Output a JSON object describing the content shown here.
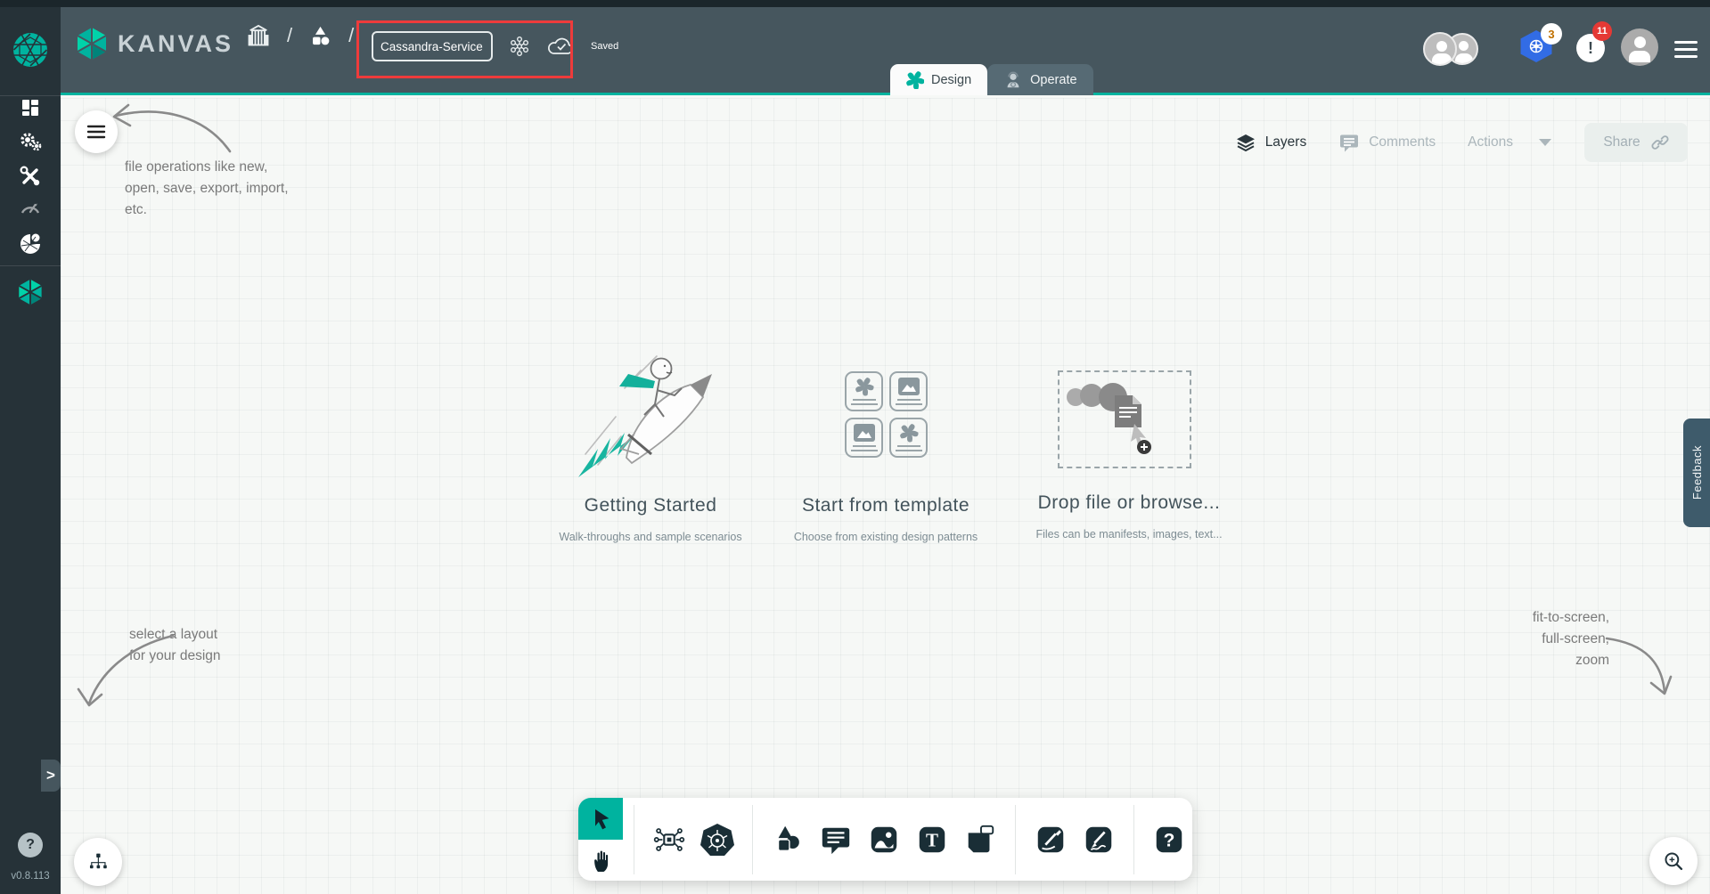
{
  "brand": {
    "name": "KANVAS"
  },
  "sidebar": {
    "items": [
      "dashboard",
      "settings",
      "toolbox",
      "performance",
      "catalog",
      "kanvas"
    ],
    "expand_chevron": ">",
    "help": "?",
    "version": "v0.8.113"
  },
  "header": {
    "separator": "/",
    "file_name": "Cassandra-Service",
    "saved_status": "Saved",
    "kubernetes_badge": "3",
    "alert_glyph": "!",
    "alert_badge": "11",
    "tabs": [
      {
        "label": "Design",
        "active": true
      },
      {
        "label": "Operate",
        "active": false
      }
    ]
  },
  "canvas_header": {
    "layers": "Layers",
    "comments": "Comments",
    "actions": "Actions",
    "share": "Share"
  },
  "empty_state": {
    "getting_started": {
      "title": "Getting Started",
      "subtitle": "Walk-throughs and sample scenarios"
    },
    "template": {
      "title": "Start from template",
      "subtitle": "Choose from existing design patterns"
    },
    "drop": {
      "title": "Drop file or browse...",
      "subtitle": "Files can be manifests, images, text..."
    }
  },
  "toolbar_tools": [
    "select",
    "pan",
    "components",
    "kubernetes",
    "shapes",
    "comment",
    "image",
    "text",
    "note",
    "pen",
    "freehand",
    "help"
  ],
  "glyphs": {
    "text_tool": "T",
    "help": "?"
  },
  "annotations": {
    "file_ops": [
      "file operations like new,",
      "open, save, export, import,",
      "etc."
    ],
    "layout": [
      "select a layout",
      "for your design"
    ],
    "zoom": [
      "fit-to-screen,",
      "full-screen,",
      "zoom"
    ]
  },
  "feedback_label": "Feedback",
  "colors": {
    "accent": "#00B39F",
    "header": "#46565E",
    "sidebar": "#263238",
    "highlight": "#ED3B3B",
    "canvas": "#F6F8F6",
    "tool_dark": "#1A2E36",
    "kubernetes_blue": "#326CE5"
  }
}
